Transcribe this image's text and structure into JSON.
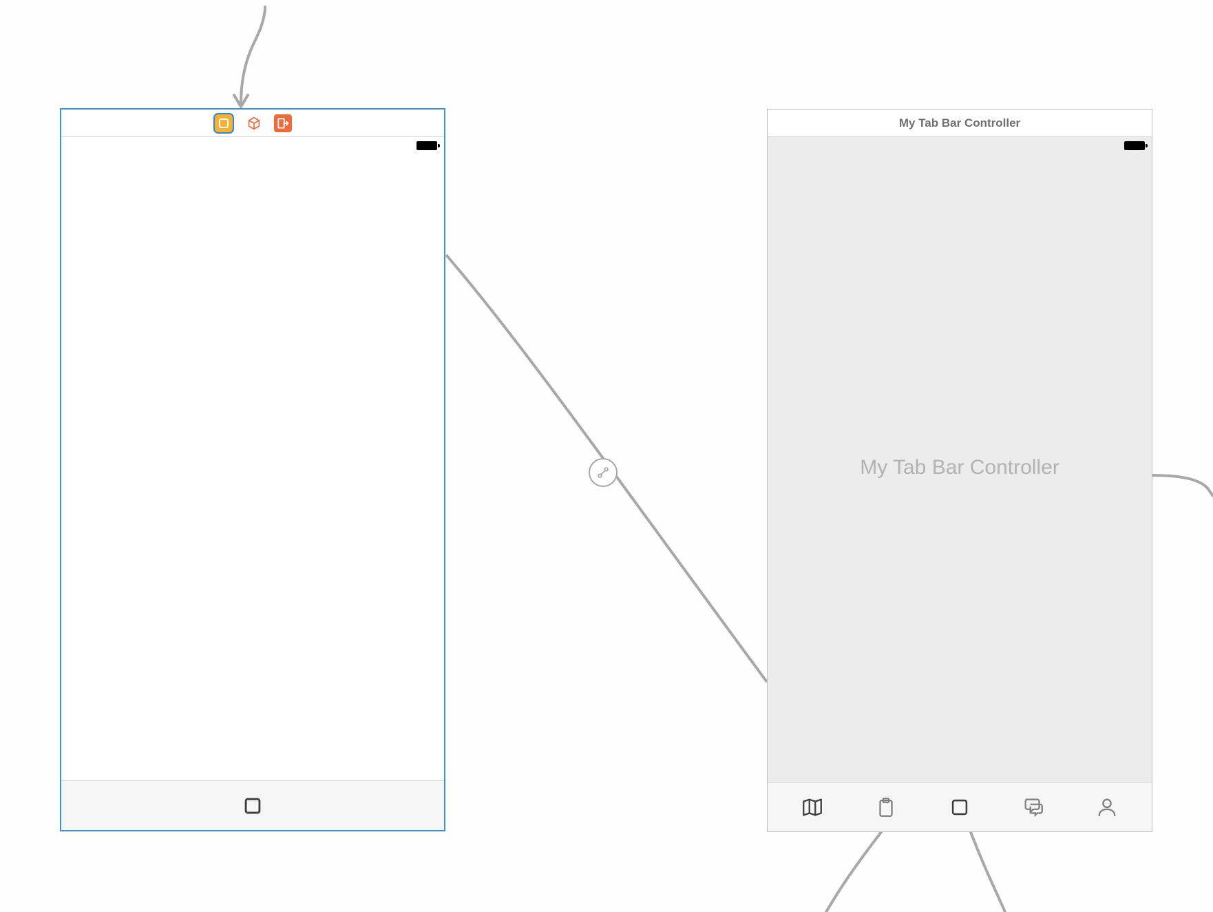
{
  "scenes": {
    "left": {
      "selected": true,
      "titlebar_icons": [
        "view-controller-icon",
        "first-responder-icon",
        "exit-icon"
      ]
    },
    "right": {
      "title": "My Tab Bar Controller",
      "placeholder": "My Tab Bar Controller",
      "tabs": [
        {
          "icon": "map-icon"
        },
        {
          "icon": "clipboard-icon"
        },
        {
          "icon": "square-icon"
        },
        {
          "icon": "chat-icon"
        },
        {
          "icon": "person-icon"
        }
      ]
    }
  },
  "segue": {
    "type": "relationship"
  }
}
